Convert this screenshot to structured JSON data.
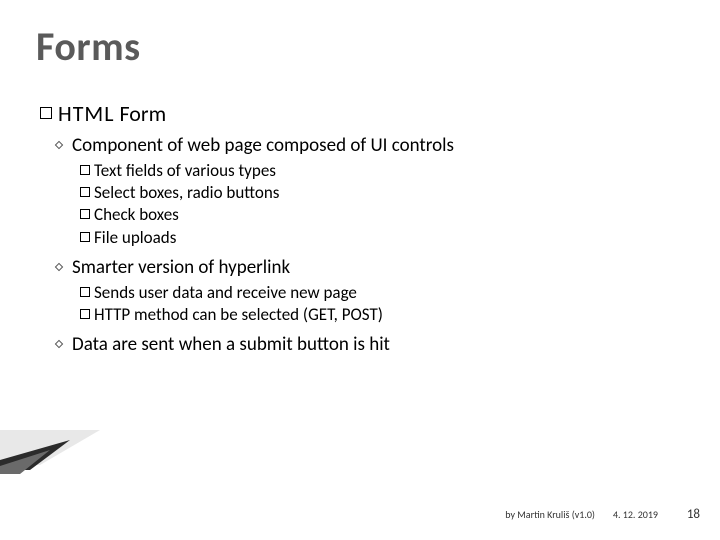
{
  "title": "Forms",
  "heading": {
    "first": "HTML",
    "rest": "Form"
  },
  "items": [
    {
      "text": "Component of web page composed of UI controls",
      "sub": [
        "Text fields of various types",
        "Select boxes, radio buttons",
        "Check boxes",
        "File uploads"
      ]
    },
    {
      "text": "Smarter version of hyperlink",
      "sub": [
        "Sends user data and receive new page",
        "HTTP method can be selected (GET, POST)"
      ]
    },
    {
      "text": "Data are sent when a submit button is hit",
      "sub": []
    }
  ],
  "footer": {
    "author": "by Martin Kruliš (v1.0)",
    "date": "4. 12. 2019",
    "page": "18"
  }
}
